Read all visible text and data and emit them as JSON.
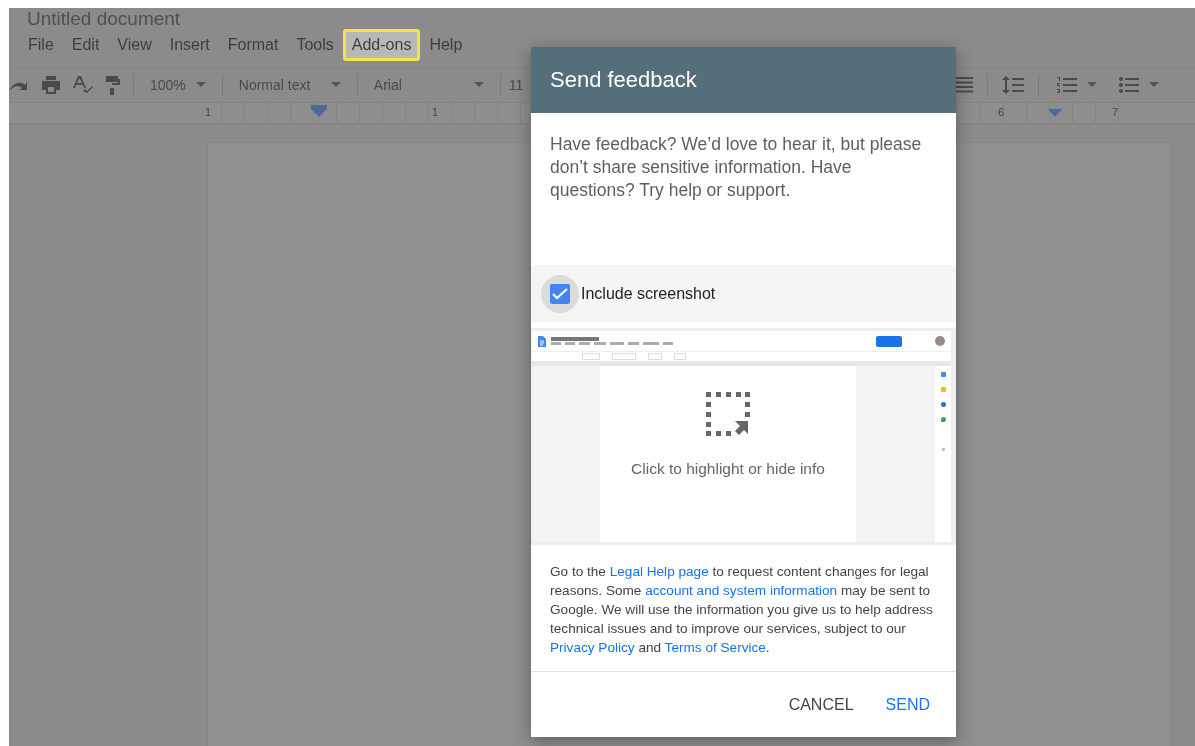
{
  "document_title": "Untitled document",
  "menu": [
    {
      "label": "File",
      "selected": false
    },
    {
      "label": "Edit",
      "selected": false
    },
    {
      "label": "View",
      "selected": false
    },
    {
      "label": "Insert",
      "selected": false
    },
    {
      "label": "Format",
      "selected": false
    },
    {
      "label": "Tools",
      "selected": false
    },
    {
      "label": "Add-ons",
      "selected": true
    },
    {
      "label": "Help",
      "selected": false
    }
  ],
  "toolbar": {
    "zoom": "100%",
    "style": "Normal text",
    "font": "Arial",
    "font_size": "11"
  },
  "ruler": {
    "labels": [
      "1",
      "1",
      "6",
      "7"
    ]
  },
  "dialog": {
    "title": "Send feedback",
    "message": "Have feedback? We’d love to hear it, but please don’t share sensitive information. Have questions? Try help or support.",
    "include_screenshot": {
      "label": "Include screenshot",
      "checked": true
    },
    "preview": {
      "hint": "Click to highlight or hide info"
    },
    "legal": [
      {
        "kind": "plain",
        "text": "Go to the "
      },
      {
        "kind": "link",
        "text": "Legal Help page"
      },
      {
        "kind": "plain",
        "text": " to request content changes for legal reasons. Some "
      },
      {
        "kind": "link",
        "text": "account and system information"
      },
      {
        "kind": "plain",
        "text": " may be sent to Google. We will use the information you give us to help address technical issues and to improve our services, subject to our "
      },
      {
        "kind": "link",
        "text": "Privacy Policy"
      },
      {
        "kind": "plain",
        "text": " and "
      },
      {
        "kind": "link",
        "text": "Terms of Service"
      },
      {
        "kind": "plain",
        "text": "."
      }
    ],
    "buttons": [
      {
        "label": "CANCEL",
        "kind": "secondary"
      },
      {
        "label": "SEND",
        "kind": "primary"
      }
    ]
  }
}
